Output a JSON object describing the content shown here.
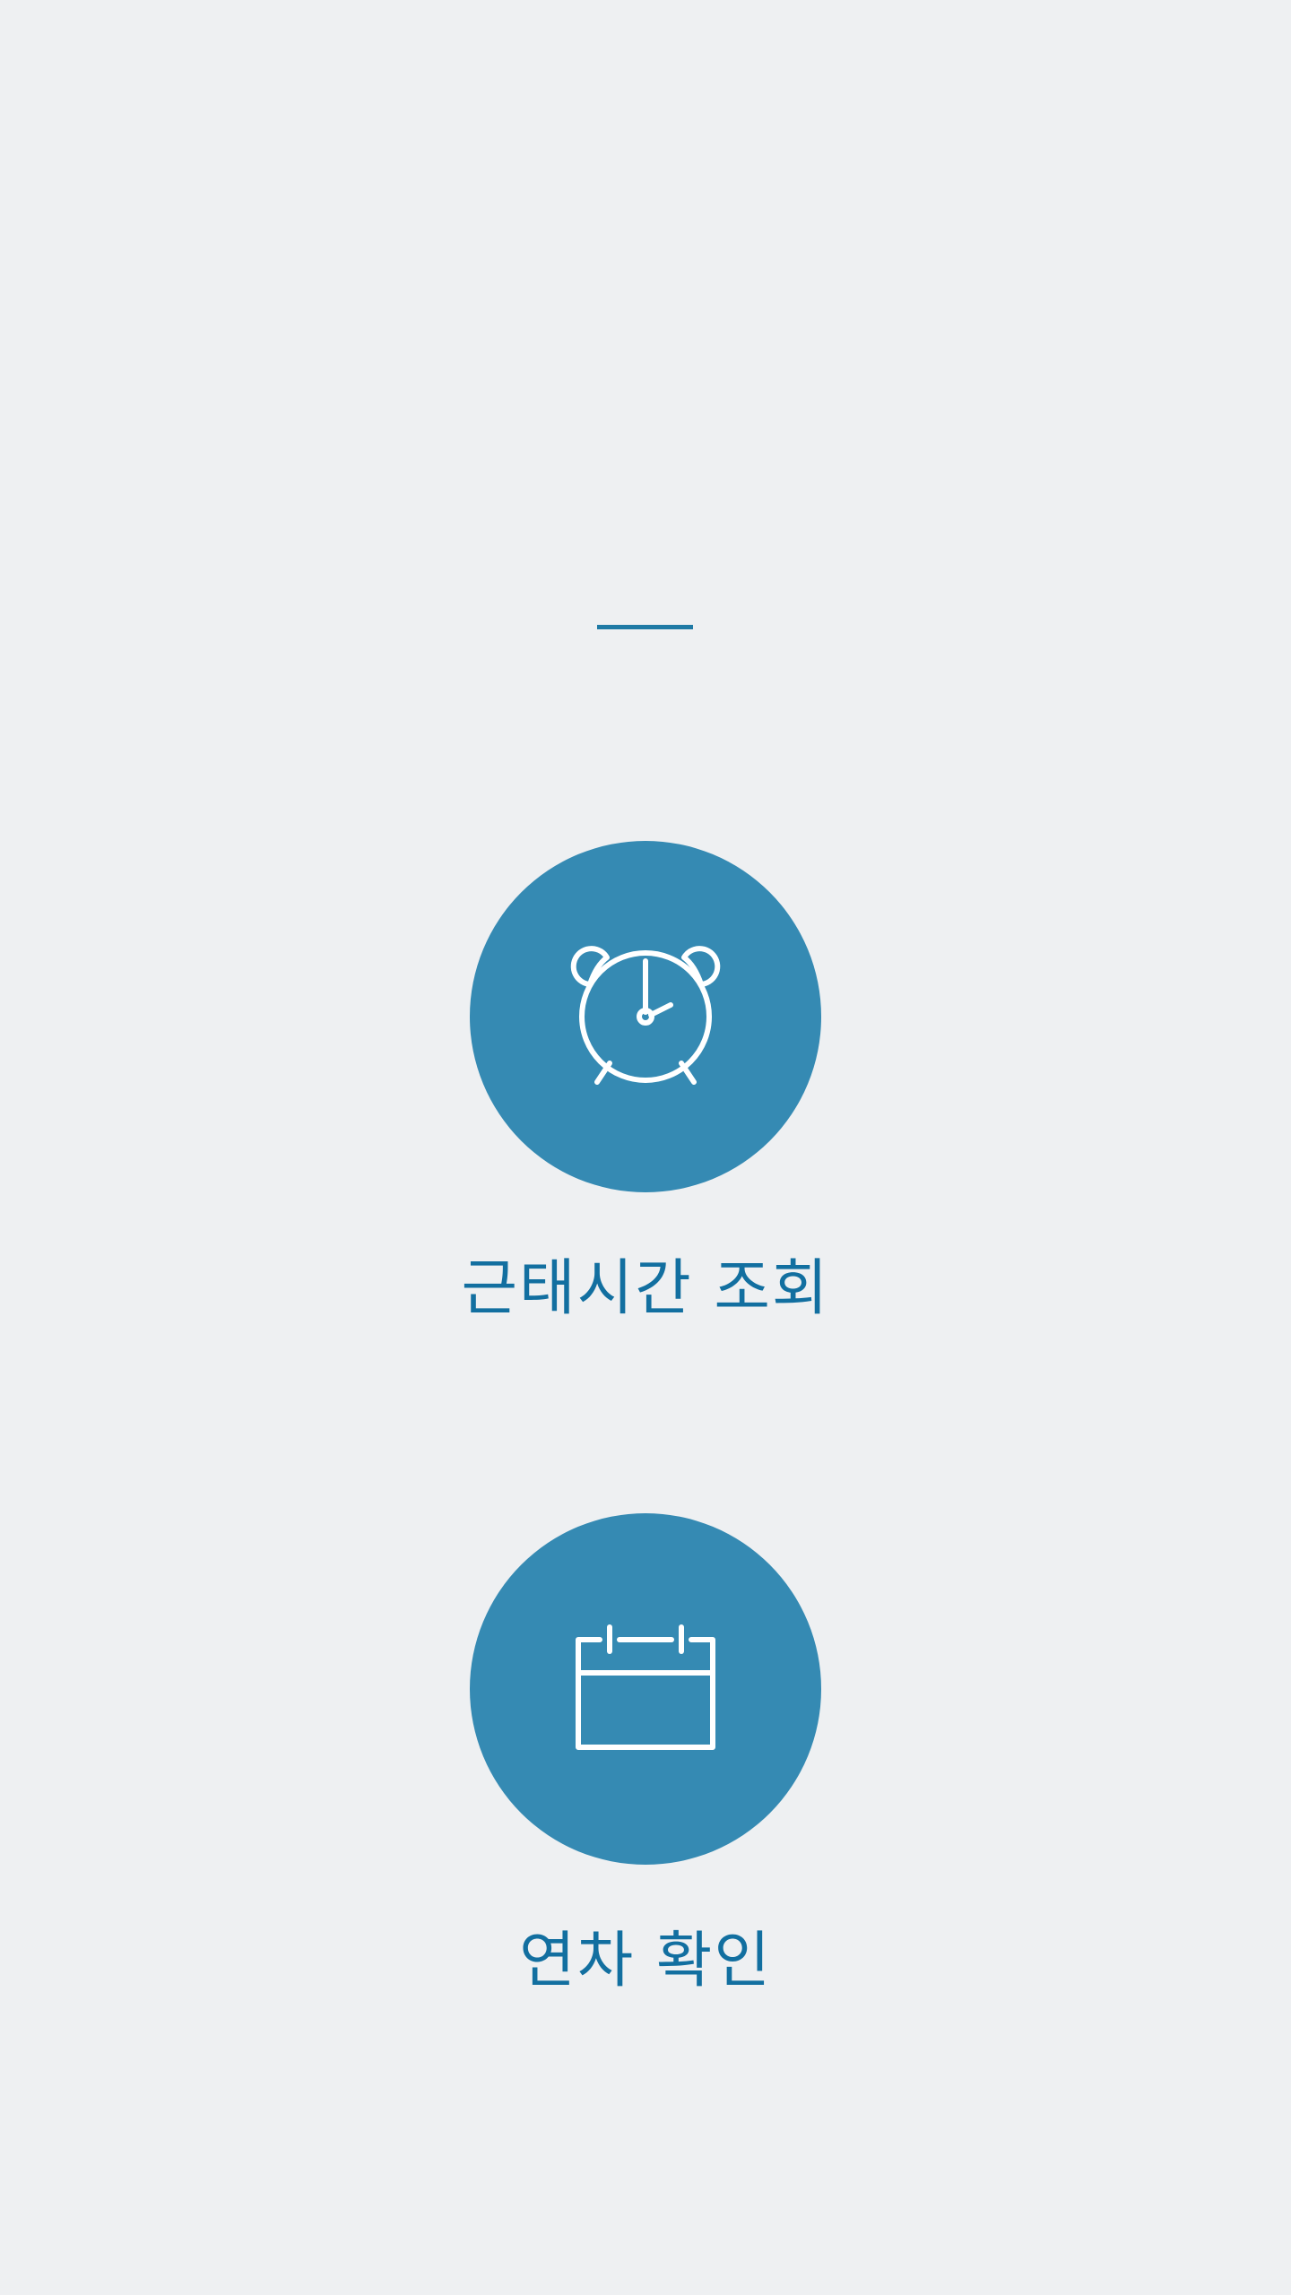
{
  "menu": {
    "items": [
      {
        "id": "attendance",
        "label": "근태시간 조회",
        "icon": "alarm-clock-icon"
      },
      {
        "id": "leave",
        "label": "연차 확인",
        "icon": "calendar-icon"
      }
    ]
  },
  "colors": {
    "background": "#eef0f2",
    "accent": "#358ab3",
    "label": "#126fa0",
    "divider": "#1f7aa5",
    "icon": "#ffffff"
  }
}
